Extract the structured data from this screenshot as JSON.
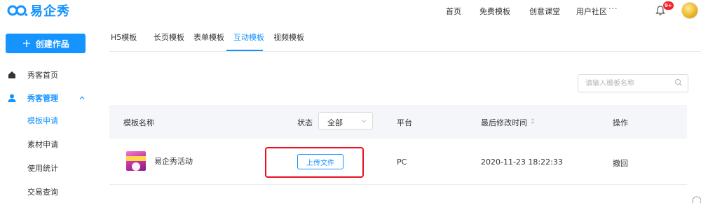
{
  "brand": {
    "name": "易企秀",
    "color": "#1593ff"
  },
  "top_nav": {
    "items": [
      {
        "label": "首页"
      },
      {
        "label": "免费模板"
      },
      {
        "label": "创意课堂"
      },
      {
        "label": "用户社区"
      }
    ],
    "more_label": "···",
    "notification_badge": "9+",
    "bell_icon": "bell-icon",
    "avatar_icon": "user-avatar"
  },
  "sidebar": {
    "create_button": {
      "label": "创建作品",
      "icon": "plus-icon"
    },
    "items": [
      {
        "label": "秀客首页",
        "icon": "home-icon"
      },
      {
        "label": "秀客管理",
        "icon": "user-icon",
        "expanded": true
      },
      {
        "label": "模板申请",
        "active": true
      },
      {
        "label": "素材申请"
      },
      {
        "label": "使用统计"
      },
      {
        "label": "交易查询"
      }
    ]
  },
  "tabs": {
    "items": [
      {
        "label": "H5模板"
      },
      {
        "label": "长页模板"
      },
      {
        "label": "表单模板"
      },
      {
        "label": "互动模板",
        "active": true
      },
      {
        "label": "视频模板"
      }
    ]
  },
  "search": {
    "placeholder": "请输入模板名称",
    "value": ""
  },
  "table": {
    "columns": {
      "name": "模板名称",
      "status": "状态",
      "platform": "平台",
      "modified": "最后修改时间",
      "actions": "操作"
    },
    "status_filter": {
      "selected": "全部"
    },
    "rows": [
      {
        "name": "易企秀活动",
        "upload_label": "上传文件",
        "platform": "PC",
        "modified": "2020-11-23 18:22:33",
        "action": "撤回"
      }
    ]
  },
  "colors": {
    "accent": "#1593ff",
    "highlight_border": "#e8101f",
    "header_bg": "#f4f6f9",
    "badge": "#f5222d"
  }
}
